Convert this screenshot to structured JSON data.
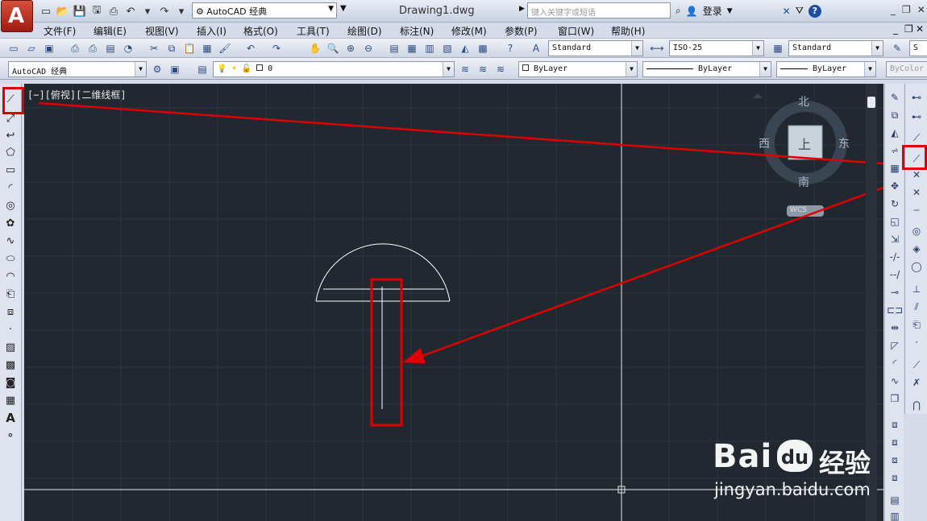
{
  "title_bar": {
    "app_logo": "A",
    "workspace": "AutoCAD 经典",
    "document_title": "Drawing1.dwg",
    "search_placeholder": "键入关键字或短语",
    "login_label": "登录",
    "help_symbol": "?"
  },
  "menu": {
    "items": [
      "文件(F)",
      "编辑(E)",
      "视图(V)",
      "插入(I)",
      "格式(O)",
      "工具(T)",
      "绘图(D)",
      "标注(N)",
      "修改(M)",
      "参数(P)",
      "窗口(W)",
      "帮助(H)"
    ]
  },
  "styles_toolbar": {
    "text_style": "Standard",
    "dim_style": "ISO-25",
    "table_style": "Standard",
    "multileader_style_partial": "S"
  },
  "layers_toolbar": {
    "workspace_combo": "AutoCAD 经典",
    "layer_name": "0",
    "color": "ByLayer",
    "linetype": "ByLayer",
    "lineweight": "ByLayer",
    "plot_style": "ByColor"
  },
  "viewport": {
    "label": "[−][俯视][二维线框]",
    "viewcube": {
      "north": "北",
      "south": "南",
      "east": "东",
      "west": "西",
      "face": "上",
      "wcs": "WCS"
    }
  },
  "watermark": {
    "brand": "Bai",
    "brand_du": "du",
    "brand_suffix": "经验",
    "url": "jingyan.baidu.com"
  },
  "colors": {
    "canvas_bg": "#212830",
    "annotation_red": "#e00000",
    "ui_bg": "#d6dbe9"
  }
}
